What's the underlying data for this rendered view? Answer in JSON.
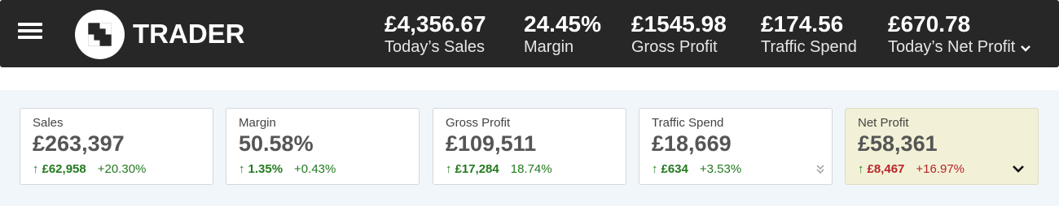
{
  "header": {
    "logo_text": "TRADER",
    "stats": [
      {
        "value": "£4,356.67",
        "label": "Today’s Sales"
      },
      {
        "value": "24.45%",
        "label": "Margin"
      },
      {
        "value": "£1545.98",
        "label": "Gross Profit"
      },
      {
        "value": "£174.56",
        "label": "Traffic Spend"
      },
      {
        "value": "£670.78",
        "label": "Today’s Net Profit"
      }
    ]
  },
  "cards": [
    {
      "title": "Sales",
      "value": "£263,397",
      "change": "£62,958",
      "pct": "+20.30%"
    },
    {
      "title": "Margin",
      "value": "50.58%",
      "change": "1.35%",
      "pct": "+0.43%"
    },
    {
      "title": "Gross Profit",
      "value": "£109,511",
      "change": "£17,284",
      "pct": "18.74%"
    },
    {
      "title": "Traffic Spend",
      "value": "£18,669",
      "change": "£634",
      "pct": "+3.53%"
    },
    {
      "title": "Net Profit",
      "value": "£58,361",
      "change": "£8,467",
      "pct": "+16.97%"
    }
  ],
  "colors": {
    "topbar": "#272727",
    "positive": "#237a1f",
    "negative": "#b8232a",
    "highlight_card": "#f2f1d7"
  }
}
